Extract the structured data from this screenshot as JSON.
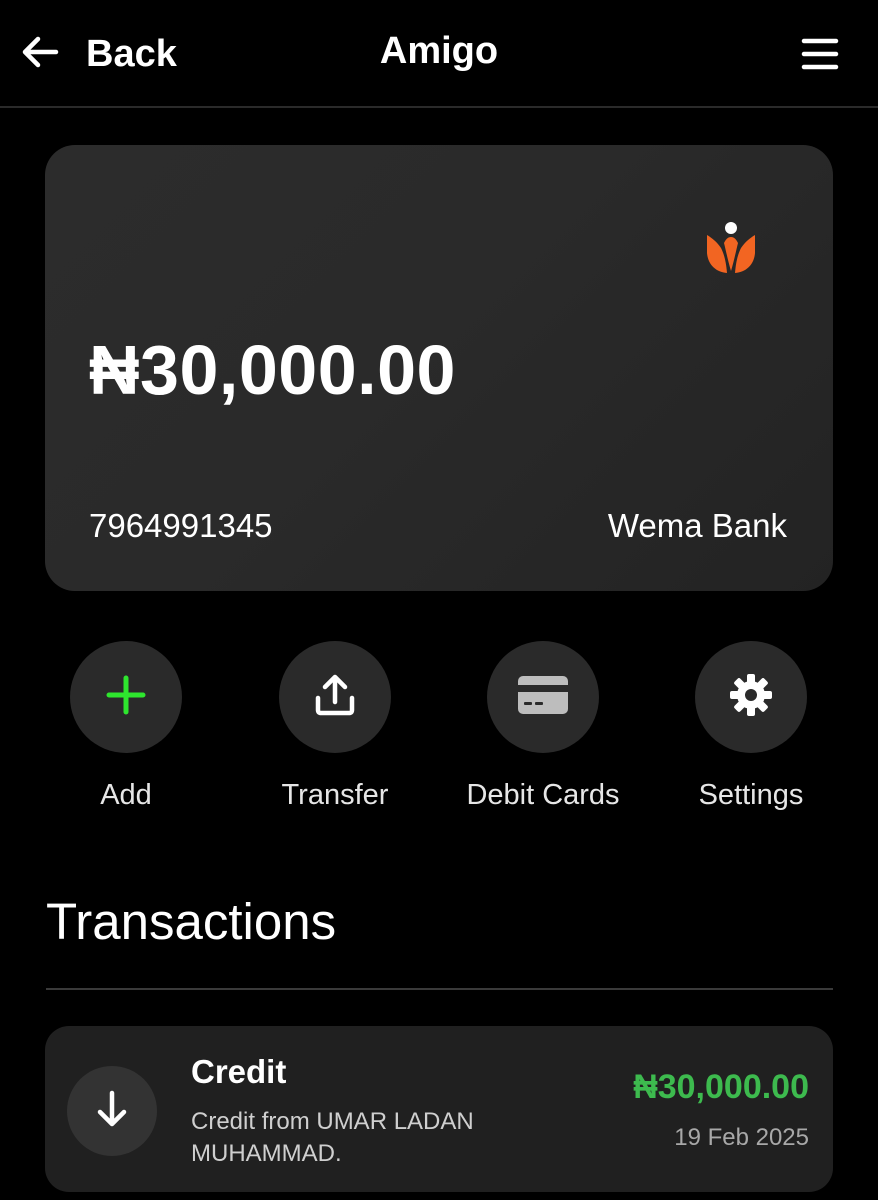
{
  "header": {
    "back_label": "Back",
    "title": "Amigo",
    "back_icon": "arrow-left-icon",
    "menu_icon": "hamburger-menu-icon"
  },
  "account": {
    "balance": "₦30,000.00",
    "account_number": "7964991345",
    "bank_name": "Wema Bank",
    "logo_icon": "wema-bank-logo",
    "logo_color": "#f26522"
  },
  "actions": [
    {
      "label": "Add",
      "icon": "plus-icon",
      "color": "#2ee62e"
    },
    {
      "label": "Transfer",
      "icon": "upload-icon"
    },
    {
      "label": "Debit Cards",
      "icon": "credit-card-icon"
    },
    {
      "label": "Settings",
      "icon": "gear-icon"
    }
  ],
  "transactions": {
    "heading": "Transactions",
    "items": [
      {
        "type": "Credit",
        "description": "Credit from UMAR LADAN MUHAMMAD.",
        "amount": "₦30,000.00",
        "date": "19 Feb 2025",
        "icon": "arrow-down-icon",
        "amount_color": "#3dba4e"
      }
    ]
  }
}
